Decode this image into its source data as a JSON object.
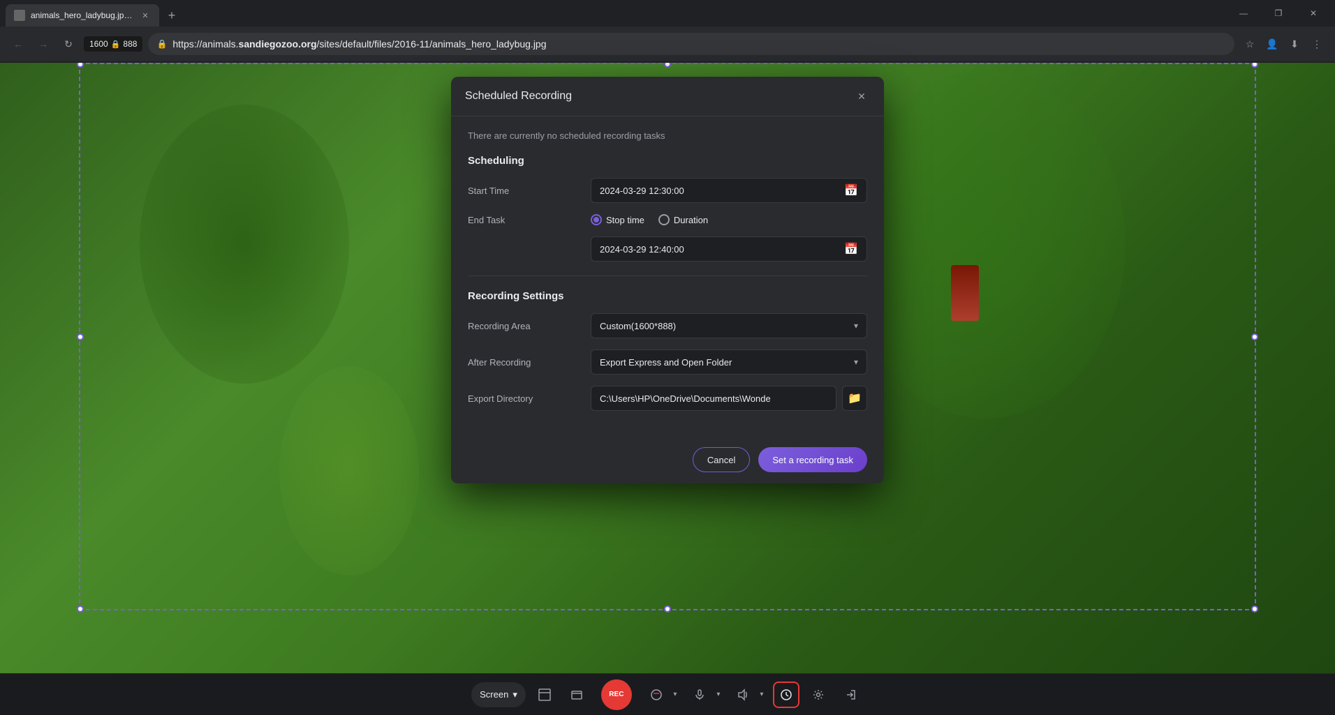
{
  "browser": {
    "tab_label": "animals_hero_ladybug.jpg (JPEG Im...",
    "tab_favicon": "image",
    "url_protocol": "https://animals.",
    "url_domain": "sandiegozoo.org",
    "url_path": "/sites/default/files/2016-11/animals_hero_ladybug.jpg",
    "dimensions_width": "1600",
    "dimensions_height": "888",
    "new_tab_label": "+",
    "win_minimize": "—",
    "win_maximize": "❐",
    "win_close": "✕",
    "nav_back": "←",
    "nav_forward": "→",
    "nav_refresh": "↻"
  },
  "dialog": {
    "title": "Scheduled Recording",
    "close_icon": "✕",
    "no_tasks_msg": "There are currently no scheduled recording tasks",
    "scheduling_title": "Scheduling",
    "start_time_label": "Start Time",
    "start_time_value": "2024-03-29 12:30:00",
    "end_task_label": "End Task",
    "stop_time_label": "Stop time",
    "duration_label": "Duration",
    "end_time_value": "2024-03-29 12:40:00",
    "recording_settings_title": "Recording Settings",
    "recording_area_label": "Recording Area",
    "recording_area_value": "Custom(1600*888)",
    "after_recording_label": "After Recording",
    "after_recording_value": "Export Express and Open Folder",
    "export_directory_label": "Export Directory",
    "export_directory_value": "C:\\Users\\HP\\OneDrive\\Documents\\Wonde",
    "cancel_btn": "Cancel",
    "set_task_btn": "Set a recording task",
    "calendar_icon": "📅",
    "folder_icon": "📁"
  },
  "toolbar": {
    "screen_label": "Screen",
    "dropdown_arrow": "▾",
    "fullscreen_icon": "⛶",
    "window_icon": "▭",
    "rec_label": "REC",
    "audio_icon": "🔇",
    "mic_icon": "🎙",
    "volume_icon": "🔊",
    "schedule_icon": "⏰",
    "settings_icon": "⚙",
    "exit_icon": "⏏"
  }
}
